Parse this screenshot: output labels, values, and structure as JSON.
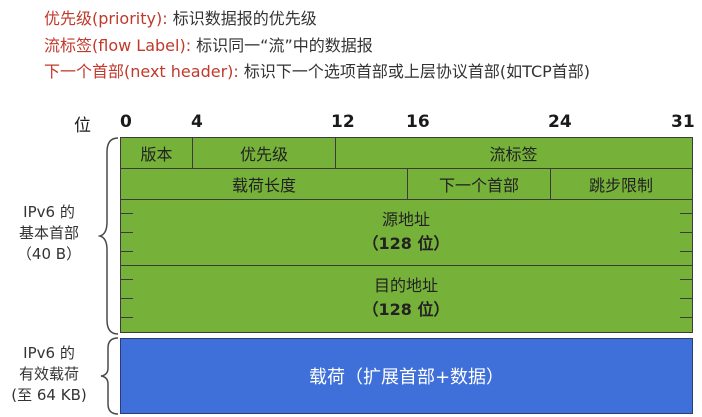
{
  "definitions": [
    {
      "term": "优先级(priority):",
      "desc": " 标识数据报的优先级"
    },
    {
      "term": "流标签(flow Label):",
      "desc": " 标识同一“流”中的数据报"
    },
    {
      "term": "下一个首部(next header):",
      "desc": " 标识下一个选项首部或上层协议首部(如TCP首部)"
    }
  ],
  "axis": {
    "label": "位",
    "ticks": [
      "0",
      "4",
      "12",
      "16",
      "24",
      "31"
    ]
  },
  "fields": {
    "version": "版本",
    "priority": "优先级",
    "flow_label": "流标签",
    "payload_length": "载荷长度",
    "next_header": "下一个首部",
    "hop_limit": "跳步限制",
    "source": "源地址",
    "source_size": "（128 位）",
    "dest": "目的地址",
    "dest_size": "（128 位）"
  },
  "payload": "载荷（扩展首部+数据）",
  "left_labels": {
    "header_line1": "IPv6 的",
    "header_line2": "基本首部",
    "header_line3": "（40 B）",
    "payload_line1": "IPv6 的",
    "payload_line2": "有效载荷",
    "payload_line3": "(至 64 KB)"
  },
  "colors": {
    "header_fill": "#76b13a",
    "payload_fill": "#3f6fd8",
    "term_text": "#c0392b"
  }
}
